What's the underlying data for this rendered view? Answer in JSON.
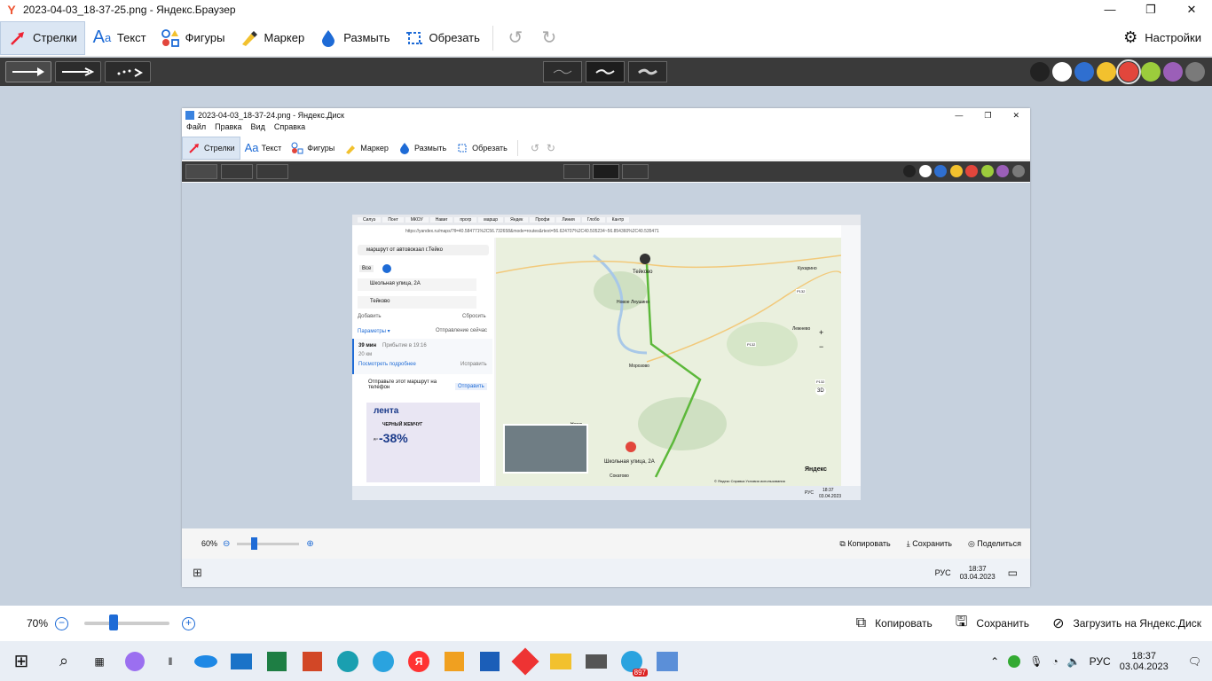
{
  "window": {
    "title": "2023-04-03_18-37-25.png - Яндекс.Браузер",
    "minimize": "—",
    "restore": "❐",
    "close": "✕"
  },
  "toolbar": {
    "tools": [
      {
        "label": "Стрелки",
        "icon": "arrow-icon",
        "active": true
      },
      {
        "label": "Текст",
        "icon": "text-icon",
        "active": false
      },
      {
        "label": "Фигуры",
        "icon": "shapes-icon",
        "active": false
      },
      {
        "label": "Маркер",
        "icon": "marker-icon",
        "active": false
      },
      {
        "label": "Размыть",
        "icon": "blur-icon",
        "active": false
      },
      {
        "label": "Обрезать",
        "icon": "crop-icon",
        "active": false
      }
    ],
    "settings_label": "Настройки"
  },
  "colors": {
    "palette": [
      "#222222",
      "#ffffff",
      "#2f6fd0",
      "#f2c12e",
      "#e2463c",
      "#9ccc3c",
      "#9b5fb8",
      "#7a7a7a"
    ],
    "selected": "#e2463c"
  },
  "inner": {
    "title": "2023-04-03_18-37-24.png - Яндекс.Диск",
    "menu": [
      "Файл",
      "Правка",
      "Вид",
      "Справка"
    ],
    "tools": [
      "Стрелки",
      "Текст",
      "Фигуры",
      "Маркер",
      "Размыть",
      "Обрезать"
    ],
    "zoom": "60%",
    "copy_label": "Копировать",
    "save_label": "Сохранить",
    "share_label": "Поделиться",
    "time": "18:37",
    "date": "03.04.2023",
    "lang": "РУС",
    "screenshot": {
      "url": "https://yandex.ru/maps/?ll=40.584771%2C56.732658&mode=routes&rtext=56.624707%2C40.505234~56.854360%2C40.535471",
      "tabs": [
        "Силуэ",
        "Понт",
        "МКОУ",
        "Навиг",
        "прогр",
        "маршр",
        "Яндек",
        "Профи",
        "Линия",
        "Глобо",
        "Кантр"
      ],
      "search_text": "маршрут от автовокзал г.Тейко",
      "modes": [
        "Все"
      ],
      "from": "Школьная улица, 2А",
      "to": "Тейково",
      "add_label": "Добавить",
      "reset_label": "Сбросить",
      "params_label": "Параметры ▾",
      "depart_label": "Отправление сейчас",
      "duration": "39 мин",
      "arrival": "Прибытие в 19:16",
      "distance": "20 км",
      "details_label": "Посмотреть подробнее",
      "fix_label": "Исправить",
      "send_text": "Отправьте этот маршрут на телефон",
      "send_button": "Отправить",
      "ad_brand": "лента",
      "ad_product": "ЧЕРНЫЙ ЖЕМЧУГ",
      "ad_discount": "-38%",
      "ad_prefix": "до",
      "map_labels": {
        "teykovo": "Тейково",
        "novoe": "Новое Леушино",
        "morozovo": "Морозово",
        "nerl": "Нерль",
        "school": "Школьная улица, 2А",
        "sokolovo": "Сокатово",
        "lezhnevo": "Лежнево",
        "kukarino": "Кукарино"
      },
      "road_badges": [
        "Р132",
        "Р132",
        "Р132"
      ],
      "map_brand": "Яндекс",
      "map_footer": "© Яндекс  Справка  Условия использования",
      "zoom_in": "+",
      "zoom_out": "−",
      "three_d": "3D",
      "time": "18:37",
      "date": "03.04.2023",
      "lang": "РУС"
    }
  },
  "bottom": {
    "zoom": "70%",
    "zoom_value_percent": 33,
    "copy_label": "Копировать",
    "save_label": "Сохранить",
    "upload_label": "Загрузить на Яндекс.Диск"
  },
  "taskbar": {
    "badge": "897",
    "lang": "РУС",
    "time": "18:37",
    "date": "03.04.2023"
  }
}
